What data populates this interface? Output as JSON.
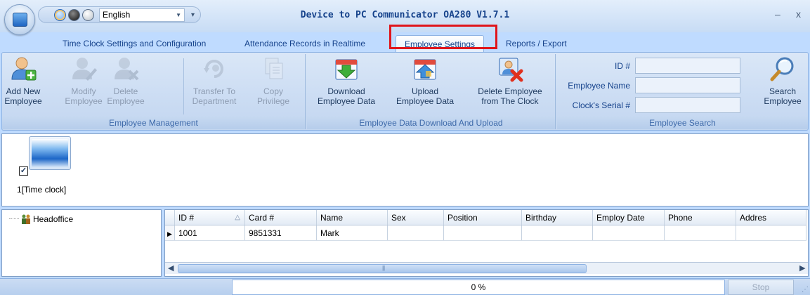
{
  "window": {
    "title": "Device to PC Communicator OA280 V1.7.1",
    "language": "English",
    "minimize_glyph": "–",
    "close_glyph": "x"
  },
  "tabs": [
    {
      "label": "Time Clock Settings and Configuration",
      "active": false
    },
    {
      "label": "Attendance Records in Realtime",
      "active": false
    },
    {
      "label": "Employee Settings",
      "active": true
    },
    {
      "label": "Reports / Export",
      "active": false
    }
  ],
  "ribbon": {
    "management": {
      "label": "Employee Management",
      "buttons": [
        {
          "line1": "Add New",
          "line2": "Employee",
          "icon": "add-employee-icon",
          "enabled": true
        },
        {
          "line1": "Modify",
          "line2": "Employee",
          "icon": "modify-employee-icon",
          "enabled": false
        },
        {
          "line1": "Delete",
          "line2": "Employee",
          "icon": "delete-employee-icon",
          "enabled": false
        },
        {
          "line1": "Transfer To",
          "line2": "Department",
          "icon": "transfer-icon",
          "enabled": false
        },
        {
          "line1": "Copy",
          "line2": "Privilege",
          "icon": "copy-icon",
          "enabled": false
        }
      ]
    },
    "transfer": {
      "label": "Employee Data Download And Upload",
      "buttons": [
        {
          "line1": "Download",
          "line2": "Employee Data",
          "icon": "download-icon",
          "enabled": true
        },
        {
          "line1": "Upload",
          "line2": "Employee Data",
          "icon": "upload-icon",
          "enabled": true
        },
        {
          "line1": "Delete Employee",
          "line2": "from The Clock",
          "icon": "delete-from-clock-icon",
          "enabled": true
        }
      ]
    },
    "search": {
      "label": "Employee Search",
      "id_label": "ID #",
      "name_label": "Employee Name",
      "serial_label": "Clock's Serial #",
      "id_value": "",
      "name_value": "",
      "serial_value": "",
      "button_line1": "Search",
      "button_line2": "Employee"
    }
  },
  "device": {
    "label": "1[Time clock]",
    "checked": true,
    "check_glyph": "✓"
  },
  "tree": {
    "root": "Headoffice"
  },
  "grid": {
    "columns": [
      "ID #",
      "Card #",
      "Name",
      "Sex",
      "Position",
      "Birthday",
      "Employ Date",
      "Phone",
      "Addres"
    ],
    "sort_glyph": "△",
    "rows": [
      {
        "id": "1001",
        "card": "9851331",
        "name": "Mark",
        "sex": "",
        "position": "",
        "birthday": "",
        "employ_date": "",
        "phone": "",
        "address": ""
      }
    ]
  },
  "status": {
    "progress_text": "0 %",
    "progress_value": 0,
    "stop_label": "Stop"
  },
  "colors": {
    "highlight": "#e0151c",
    "ribbon_text": "#15428b"
  }
}
